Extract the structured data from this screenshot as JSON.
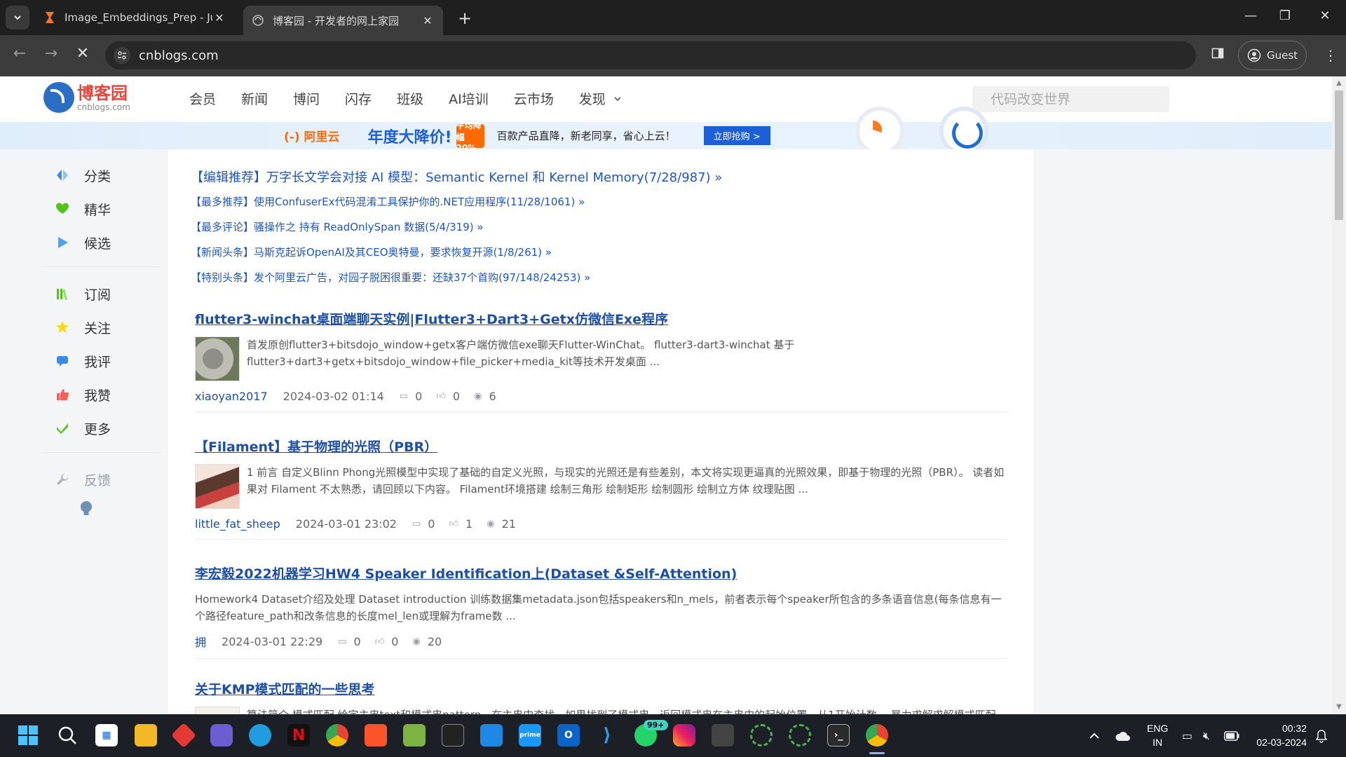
{
  "browser": {
    "tabs": [
      {
        "title": "Image_Embeddings_Prep - Jupy",
        "active": false,
        "icon": "hourglass-icon"
      },
      {
        "title": "博客园 - 开发者的网上家园",
        "active": true,
        "icon": "globe-icon"
      }
    ],
    "new_tab": "+",
    "url": "cnblogs.com",
    "profile_label": "Guest"
  },
  "site": {
    "logo_title": "博客园",
    "logo_sub": "cnblogs.com",
    "nav": [
      "会员",
      "新闻",
      "博问",
      "闪存",
      "班级",
      "AI培训",
      "云市场",
      "发现"
    ],
    "search_placeholder": "代码改变世界"
  },
  "ad": {
    "brand": "(-) 阿里云",
    "headline": "年度大降价!",
    "badge": "平均降幅 20%",
    "text": "百款产品直降，新老同享，省心上云！",
    "button": "立即抢购 >"
  },
  "sidebar": {
    "group1": [
      {
        "label": "分类",
        "icon": "category-icon",
        "color": "#3b8beb"
      },
      {
        "label": "精华",
        "icon": "heart-icon",
        "color": "#52c41a"
      },
      {
        "label": "候选",
        "icon": "play-icon",
        "color": "#4aa3f0"
      }
    ],
    "group2": [
      {
        "label": "订阅",
        "icon": "books-icon",
        "color": "#52c41a"
      },
      {
        "label": "关注",
        "icon": "star-icon",
        "color": "#fadb14"
      },
      {
        "label": "我评",
        "icon": "comment-icon",
        "color": "#3b8beb"
      },
      {
        "label": "我赞",
        "icon": "thumb-icon",
        "color": "#f5625b"
      },
      {
        "label": "更多",
        "icon": "check-icon",
        "color": "#52c41a"
      }
    ],
    "feedback": "反馈"
  },
  "picks": {
    "main": "【编辑推荐】万字长文学会对接 AI 模型：Semantic Kernel 和 Kernel Memory(7/28/987) »",
    "items": [
      "【最多推荐】使用ConfuserEx代码混淆工具保护你的.NET应用程序(11/28/1061) »",
      "【最多评论】骚操作之 持有 ReadOnlySpan 数据(5/4/319) »",
      "【新闻头条】马斯克起诉OpenAI及其CEO奥特曼，要求恢复开源(1/8/261) »",
      "【特别头条】发个阿里云广告，对园子脱困很重要：还缺37个首购(97/148/24253) »"
    ]
  },
  "posts": [
    {
      "title": "flutter3-winchat桌面端聊天实例|Flutter3+Dart3+Getx仿微信Exe程序",
      "summary": "首发原创flutter3+bitsdojo_window+getx客户端仿微信exe聊天Flutter-WinChat。 flutter3-dart3-winchat 基于flutter3+dart3+getx+bitsdojo_window+file_picker+media_kit等技术开发桌面 ...",
      "author": "xiaoyan2017",
      "date": "2024-03-02 01:14",
      "comments": "0",
      "likes": "0",
      "views": "6"
    },
    {
      "title": "【Filament】基于物理的光照（PBR）",
      "summary": "1 前言 自定义Blinn Phong光照模型中实现了基础的自定义光照，与现实的光照还是有些差别，本文将实现更逼真的光照效果，即基于物理的光照（PBR）。 读者如果对 Filament 不太熟悉，请回顾以下内容。 Filament环境搭建 绘制三角形 绘制矩形 绘制圆形 绘制立方体 纹理贴图 ...",
      "author": "little_fat_sheep",
      "date": "2024-03-01 23:02",
      "comments": "0",
      "likes": "1",
      "views": "21"
    },
    {
      "title": "李宏毅2022机器学习HW4 Speaker Identification上(Dataset &Self-Attention)",
      "summary": "Homework4 Dataset介绍及处理 Dataset introduction 训练数据集metadata.json包括speakers和n_mels，前者表示每个speaker所包含的多条语音信息(每条信息有一个路径feature_path和改条信息的长度mel_len或理解为frame数 ...",
      "author": "拥",
      "date": "2024-03-01 22:29",
      "comments": "0",
      "likes": "0",
      "views": "20"
    },
    {
      "title": "关于KMP模式匹配的一些思考",
      "summary": "算法简介 模式匹配 给定主串text和模式串pattern，在主串中查找，如果找到了模式串，返回模式串在主串中的起始位置，从1开始计数。 暴力求解求解模式匹配 算"
    }
  ],
  "taskbar": {
    "lang_top": "ENG",
    "lang_bottom": "IN",
    "time": "00:32",
    "date": "02-03-2024",
    "whatsapp_badge": "99+"
  }
}
